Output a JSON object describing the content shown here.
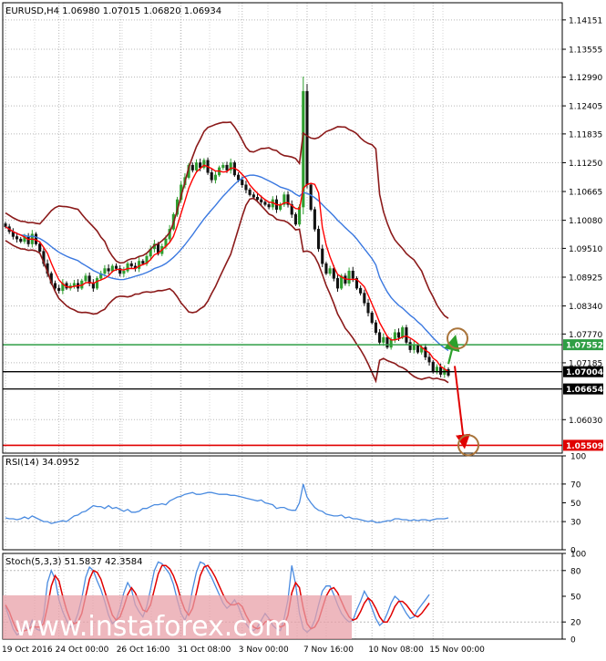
{
  "colors": {
    "frame": "#000000",
    "grid": "#b8b8b8",
    "bull": "#2e9e2e",
    "bear": "#111111",
    "bollinger": "#8b1a1a",
    "ma_red": "#ff0000",
    "ma_blue": "#3a78e0",
    "level_green": "#2e9e44",
    "level_black": "#000000",
    "level_red": "#e00000",
    "rsi_line": "#4a8be0",
    "stoch_main": "#4a8be0",
    "stoch_signal": "#e00000",
    "arrow_up": "#2ca02c",
    "arrow_down": "#e00000",
    "circle": "#a9743a",
    "watermark_band": "#e8a0a8",
    "watermark_text": "#ffffff"
  },
  "chart_data": [
    {
      "type": "candlestick",
      "title": "EURUSD,H4  1.06980 1.07015 1.06820 1.06934",
      "ylim": [
        1.0535,
        1.145
      ],
      "y_ticks": [
        "1.14151",
        "1.13555",
        "1.12990",
        "1.12405",
        "1.11835",
        "1.11250",
        "1.10665",
        "1.10080",
        "1.09510",
        "1.08925",
        "1.08340",
        "1.07770",
        "1.07185",
        "1.06030"
      ],
      "y_tick_values": [
        1.14151,
        1.13555,
        1.1299,
        1.12405,
        1.11835,
        1.1125,
        1.10665,
        1.1008,
        1.0951,
        1.08925,
        1.0834,
        1.0777,
        1.07185,
        1.0603
      ],
      "x_ticks": [
        "19 Oct 2016",
        "24 Oct 00:00",
        "26 Oct 16:00",
        "31 Oct 08:00",
        "3 Nov 00:00",
        "7 Nov 16:00",
        "10 Nov 08:00",
        "15 Nov 00:00"
      ],
      "x_tick_index": [
        0,
        14,
        30,
        46,
        62,
        79,
        96,
        112
      ],
      "closes": [
        1.0995,
        1.0985,
        1.0975,
        1.097,
        1.0965,
        1.0975,
        1.096,
        1.098,
        1.096,
        1.0945,
        1.092,
        1.09,
        1.088,
        1.087,
        1.0865,
        1.088,
        1.087,
        1.0875,
        1.088,
        1.087,
        1.0885,
        1.0895,
        1.088,
        1.087,
        1.089,
        1.09,
        1.091,
        1.0905,
        1.0915,
        1.091,
        1.09,
        1.0905,
        1.092,
        1.0915,
        1.091,
        1.0925,
        1.092,
        1.0935,
        1.095,
        1.096,
        1.094,
        1.0955,
        1.097,
        1.099,
        1.102,
        1.105,
        1.108,
        1.1095,
        1.112,
        1.111,
        1.1125,
        1.1115,
        1.113,
        1.1105,
        1.109,
        1.11,
        1.1115,
        1.112,
        1.111,
        1.1125,
        1.11,
        1.109,
        1.108,
        1.107,
        1.106,
        1.1055,
        1.105,
        1.1045,
        1.104,
        1.1035,
        1.105,
        1.103,
        1.104,
        1.106,
        1.104,
        1.102,
        1.1,
        1.1035,
        1.127,
        1.108,
        1.103,
        1.099,
        1.095,
        1.092,
        1.09,
        1.091,
        1.089,
        1.087,
        1.0895,
        1.088,
        1.0905,
        1.089,
        1.087,
        1.086,
        1.084,
        1.082,
        1.08,
        1.078,
        1.076,
        1.077,
        1.075,
        1.0765,
        1.078,
        1.077,
        1.079,
        1.076,
        1.0745,
        1.0755,
        1.074,
        1.075,
        1.073,
        1.072,
        1.07,
        1.071,
        1.0695,
        1.0705,
        1.0693
      ],
      "levels": [
        {
          "value": 1.07552,
          "label": "1.07552",
          "color": "green"
        },
        {
          "value": 1.07004,
          "label": "1.07004",
          "color": "black"
        },
        {
          "value": 1.06654,
          "label": "1.06654",
          "color": "black"
        },
        {
          "value": 1.05509,
          "label": "1.05509",
          "color": "red"
        }
      ]
    },
    {
      "type": "line",
      "title": "RSI(14) 34.0952",
      "ylim": [
        0,
        100
      ],
      "y_ticks": [
        "100",
        "70",
        "50",
        "30",
        "0"
      ],
      "y_tick_values": [
        100,
        70,
        50,
        30,
        0
      ],
      "values": [
        34,
        33,
        33,
        32,
        33,
        35,
        33,
        36,
        34,
        32,
        30,
        30,
        28,
        29,
        30,
        31,
        30,
        33,
        36,
        37,
        40,
        41,
        44,
        47,
        46,
        46,
        44,
        47,
        44,
        45,
        43,
        41,
        43,
        40,
        40,
        41,
        44,
        44,
        46,
        48,
        48,
        49,
        48,
        52,
        54,
        56,
        57,
        59,
        60,
        61,
        59,
        59,
        60,
        61,
        61,
        60,
        59,
        59,
        59,
        58,
        58,
        57,
        56,
        55,
        54,
        53,
        52,
        53,
        50,
        49,
        48,
        44,
        45,
        45,
        43,
        42,
        42,
        50,
        70,
        56,
        50,
        45,
        42,
        41,
        38,
        37,
        36,
        36,
        37,
        34,
        35,
        33,
        33,
        32,
        31,
        30,
        31,
        29,
        29,
        30,
        31,
        31,
        33,
        33,
        32,
        32,
        31,
        32,
        31,
        32,
        32,
        31,
        32,
        33,
        33,
        33,
        34
      ]
    },
    {
      "type": "line",
      "title": "Stoch(5,3,3) 51.5837 42.3584",
      "ylim": [
        0,
        100
      ],
      "y_ticks": [
        "100",
        "80",
        "50",
        "20",
        "0"
      ],
      "y_tick_values": [
        100,
        80,
        50,
        20,
        0
      ],
      "series": [
        {
          "values": [
            38,
            25,
            12,
            5,
            8,
            14,
            10,
            22,
            12,
            10,
            28,
            66,
            80,
            70,
            46,
            32,
            22,
            14,
            18,
            30,
            48,
            72,
            84,
            80,
            68,
            58,
            44,
            28,
            18,
            22,
            36,
            54,
            66,
            58,
            40,
            32,
            26,
            38,
            58,
            80,
            90,
            88,
            82,
            76,
            64,
            46,
            30,
            22,
            34,
            58,
            78,
            90,
            88,
            80,
            72,
            62,
            52,
            42,
            36,
            40,
            46,
            38,
            26,
            18,
            12,
            10,
            14,
            22,
            30,
            24,
            16,
            12,
            10,
            24,
            46,
            86,
            64,
            30,
            12,
            8,
            12,
            22,
            40,
            56,
            62,
            62,
            52,
            40,
            30,
            24,
            20,
            22,
            34,
            44,
            56,
            48,
            36,
            24,
            16,
            20,
            30,
            42,
            50,
            46,
            38,
            30,
            24,
            26,
            34,
            40,
            46,
            52
          ]
        },
        {
          "values": [
            40,
            32,
            20,
            10,
            8,
            10,
            11,
            15,
            14,
            14,
            18,
            38,
            62,
            74,
            68,
            50,
            34,
            22,
            18,
            20,
            30,
            50,
            70,
            80,
            78,
            70,
            56,
            42,
            28,
            22,
            26,
            38,
            52,
            60,
            54,
            44,
            34,
            32,
            40,
            58,
            76,
            86,
            86,
            82,
            74,
            62,
            46,
            34,
            28,
            36,
            54,
            74,
            84,
            86,
            80,
            72,
            62,
            52,
            44,
            40,
            40,
            42,
            38,
            28,
            20,
            14,
            12,
            14,
            20,
            22,
            22,
            18,
            14,
            16,
            28,
            54,
            66,
            60,
            36,
            18,
            12,
            14,
            22,
            36,
            50,
            58,
            60,
            54,
            44,
            34,
            26,
            22,
            24,
            32,
            42,
            48,
            44,
            36,
            26,
            20,
            20,
            28,
            38,
            44,
            44,
            40,
            34,
            28,
            26,
            30,
            36,
            42
          ]
        }
      ]
    }
  ],
  "watermark": {
    "text": "www.instaforex.com"
  }
}
